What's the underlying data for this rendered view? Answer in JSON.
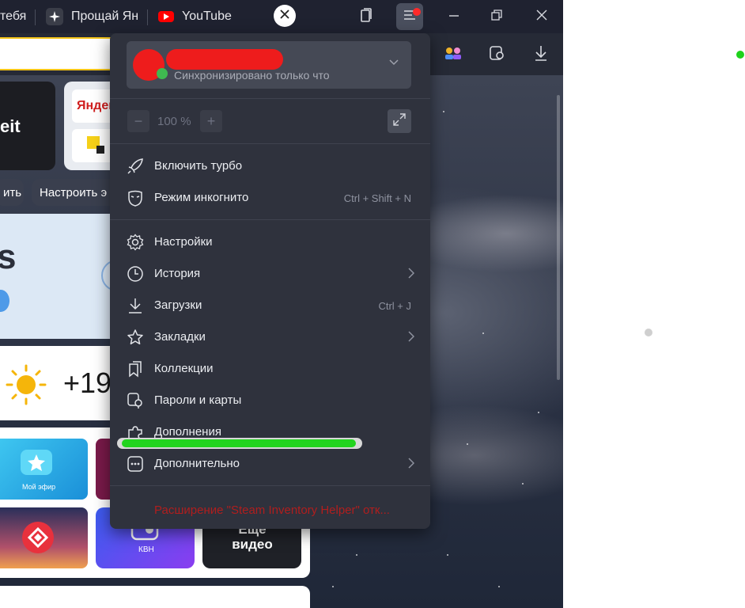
{
  "tabs": [
    {
      "label": "тебя"
    },
    {
      "label": "Прощай Ян"
    },
    {
      "label": "YouTube"
    }
  ],
  "menu": {
    "profile": {
      "status": "Синхронизировано только что"
    },
    "zoom": {
      "minus": "−",
      "value": "100 %",
      "plus": "+"
    },
    "items": [
      {
        "label": "Включить турбо",
        "shortcut": ""
      },
      {
        "label": "Режим инкогнито",
        "shortcut": "Ctrl + Shift + N"
      },
      {
        "label": "Настройки",
        "shortcut": ""
      },
      {
        "label": "История",
        "shortcut": ""
      },
      {
        "label": "Загрузки",
        "shortcut": "Ctrl + J"
      },
      {
        "label": "Закладки",
        "shortcut": ""
      },
      {
        "label": "Коллекции",
        "shortcut": ""
      },
      {
        "label": "Пароли и карты",
        "shortcut": ""
      },
      {
        "label": "Дополнения",
        "shortcut": ""
      },
      {
        "label": "Дополнительно",
        "shortcut": ""
      }
    ],
    "notice": "Расширение \"Steam Inventory Helper\" отк..."
  },
  "dashboard": {
    "tile_text": "eit",
    "yandex_label": "Яндекс",
    "pill_left": "ить",
    "pill_right": "Настроить э",
    "banner_letter": "s",
    "weather_temp": "+19",
    "video_tiles": [
      {
        "label": "Мой эфир"
      },
      {
        "label": "КВН"
      },
      {
        "label": "Еще видео"
      }
    ]
  },
  "colors": {
    "accent_yellow": "#f5c518",
    "menu_bg": "#2f323d",
    "notice_red": "#b01e1e",
    "redaction_red": "#ee1c1c",
    "highlight_green": "#22d41e"
  }
}
